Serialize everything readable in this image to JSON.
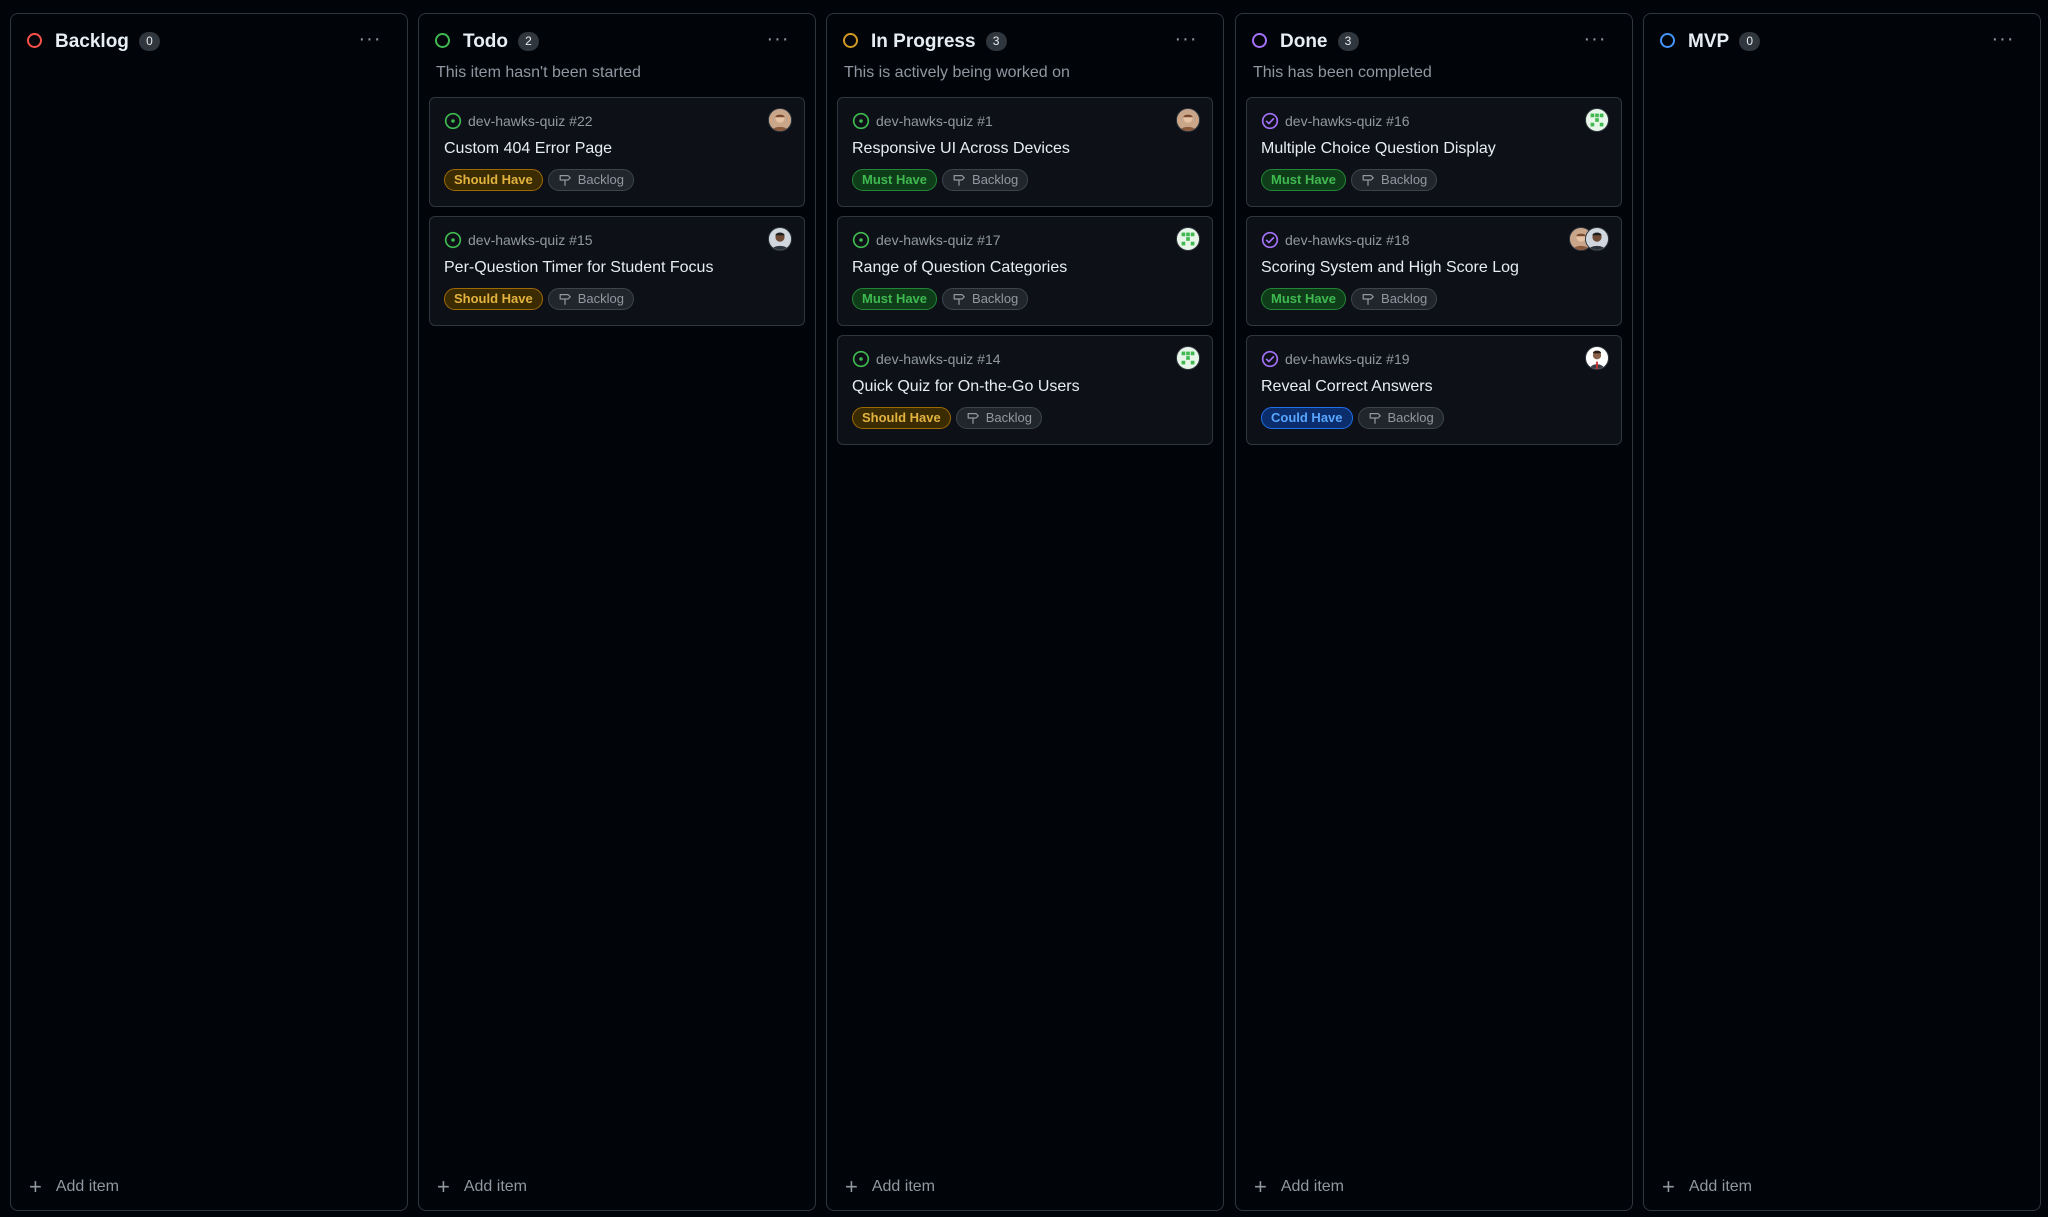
{
  "columns": [
    {
      "title": "Backlog",
      "count": "0",
      "description": "",
      "status_color": "#f85149",
      "add_label": "Add item",
      "cards": []
    },
    {
      "title": "Todo",
      "count": "2",
      "description": "This item hasn't been started",
      "status_color": "#3fb950",
      "add_label": "Add item",
      "cards": [
        {
          "repo": "dev-hawks-quiz #22",
          "title": "Custom 404 Error Page",
          "priority": "Should Have",
          "priority_type": "should",
          "milestone": "Backlog",
          "state": "open",
          "avatars": [
            "person-a"
          ]
        },
        {
          "repo": "dev-hawks-quiz #15",
          "title": "Per-Question Timer for Student Focus",
          "priority": "Should Have",
          "priority_type": "should",
          "milestone": "Backlog",
          "state": "open",
          "avatars": [
            "person-b"
          ]
        }
      ]
    },
    {
      "title": "In Progress",
      "count": "3",
      "description": "This is actively being worked on",
      "status_color": "#d29922",
      "add_label": "Add item",
      "cards": [
        {
          "repo": "dev-hawks-quiz #1",
          "title": "Responsive UI Across Devices",
          "priority": "Must Have",
          "priority_type": "must",
          "milestone": "Backlog",
          "state": "open",
          "avatars": [
            "person-a"
          ]
        },
        {
          "repo": "dev-hawks-quiz #17",
          "title": "Range of Question Categories",
          "priority": "Must Have",
          "priority_type": "must",
          "milestone": "Backlog",
          "state": "open",
          "avatars": [
            "identicon-green"
          ]
        },
        {
          "repo": "dev-hawks-quiz #14",
          "title": "Quick Quiz for On-the-Go Users",
          "priority": "Should Have",
          "priority_type": "should",
          "milestone": "Backlog",
          "state": "open",
          "avatars": [
            "identicon-green"
          ]
        }
      ]
    },
    {
      "title": "Done",
      "count": "3",
      "description": "This has been completed",
      "status_color": "#a371f7",
      "add_label": "Add item",
      "cards": [
        {
          "repo": "dev-hawks-quiz #16",
          "title": "Multiple Choice Question Display",
          "priority": "Must Have",
          "priority_type": "must",
          "milestone": "Backlog",
          "state": "closed",
          "avatars": [
            "identicon-green"
          ]
        },
        {
          "repo": "dev-hawks-quiz #18",
          "title": "Scoring System and High Score Log",
          "priority": "Must Have",
          "priority_type": "must",
          "milestone": "Backlog",
          "state": "closed",
          "avatars": [
            "person-a",
            "person-b"
          ]
        },
        {
          "repo": "dev-hawks-quiz #19",
          "title": "Reveal Correct Answers",
          "priority": "Could Have",
          "priority_type": "could",
          "milestone": "Backlog",
          "state": "closed",
          "avatars": [
            "person-c"
          ]
        }
      ]
    },
    {
      "title": "MVP",
      "count": "0",
      "description": "",
      "status_color": "#4493f8",
      "add_label": "Add item",
      "cards": []
    }
  ],
  "more_glyph": "···",
  "plus_glyph": "+",
  "colors": {
    "open_issue": "#3fb950",
    "closed_issue": "#a371f7",
    "background": "#010409",
    "card": "#0d1117",
    "border": "#30363d"
  }
}
